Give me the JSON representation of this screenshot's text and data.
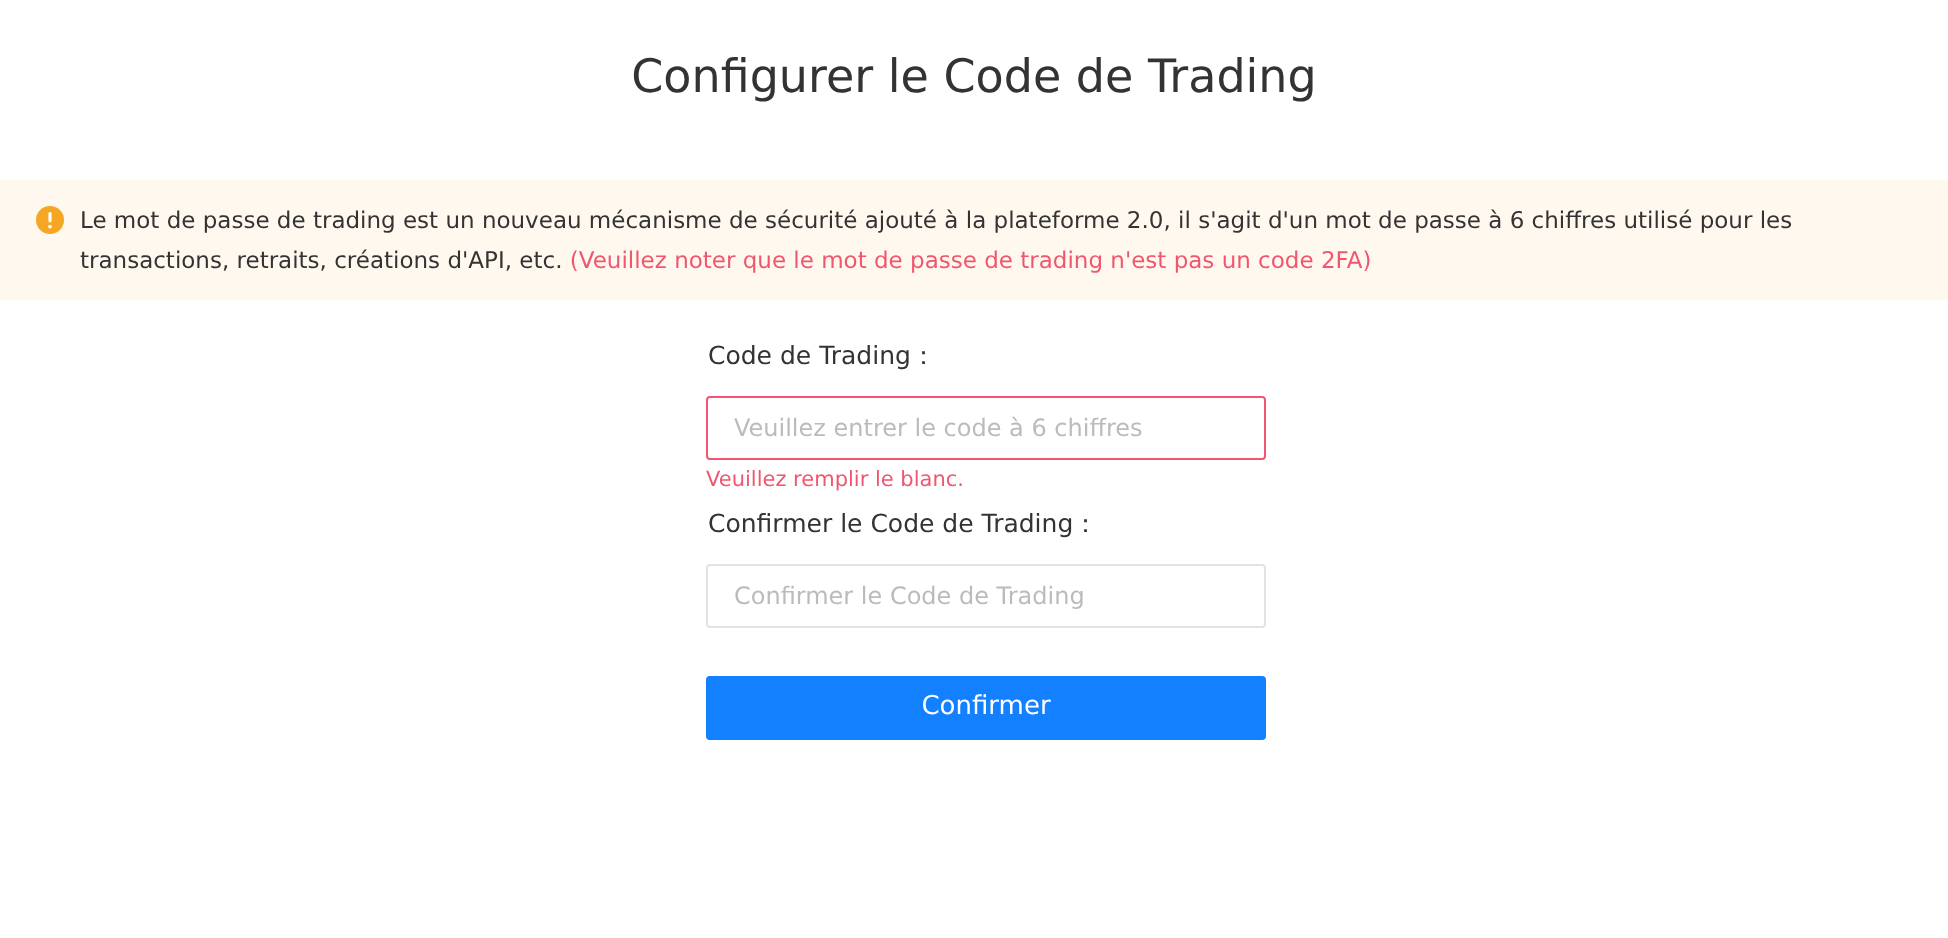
{
  "title": "Configurer le Code de Trading",
  "notice": {
    "text": "Le mot de passe de trading est un nouveau mécanisme de sécurité ajouté à la plateforme 2.0, il s'agit d'un mot de passe à 6 chiffres utilisé pour les transactions, retraits, créations d'API, etc.",
    "highlight": "(Veuillez noter que le mot de passe de trading n'est pas un code 2FA)"
  },
  "fields": [
    {
      "label": "Code de Trading：",
      "placeholder": "Veuillez entrer le code à 6 chiffres",
      "error": "Veuillez remplir le blanc."
    },
    {
      "label": "Confirmer le Code de Trading：",
      "placeholder": "Confirmer le Code de Trading"
    }
  ],
  "submit": "Confirmer"
}
